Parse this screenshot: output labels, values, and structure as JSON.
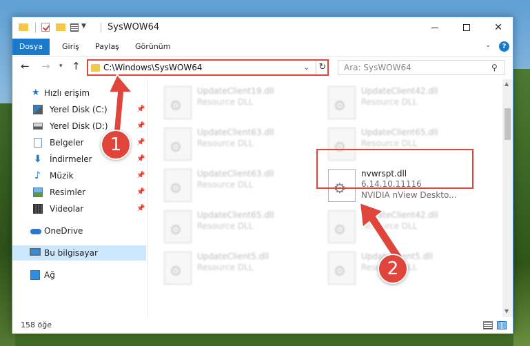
{
  "window": {
    "title": "SysWOW64"
  },
  "ribbon": {
    "tabs": [
      "Dosya",
      "Giriş",
      "Paylaş",
      "Görünüm"
    ]
  },
  "address": {
    "path": "C:\\Windows\\SysWOW64"
  },
  "search": {
    "placeholder": "Ara: SysWOW64"
  },
  "navpane": {
    "items": [
      {
        "label": "Hızlı erişim",
        "icon": "star-icon"
      },
      {
        "label": "Yerel Disk (C:)",
        "icon": "drive-icon",
        "pinned": true
      },
      {
        "label": "Yerel Disk (D:)",
        "icon": "drive-icon",
        "pinned": true
      },
      {
        "label": "Belgeler",
        "icon": "documents-icon",
        "pinned": true
      },
      {
        "label": "İndirmeler",
        "icon": "download-icon",
        "pinned": true
      },
      {
        "label": "Müzik",
        "icon": "music-icon",
        "pinned": true
      },
      {
        "label": "Resimler",
        "icon": "pictures-icon",
        "pinned": true
      },
      {
        "label": "Videolar",
        "icon": "videos-icon",
        "pinned": true
      },
      {
        "label": "OneDrive",
        "icon": "onedrive-icon"
      },
      {
        "label": "Bu bilgisayar",
        "icon": "this-pc-icon",
        "selected": true
      },
      {
        "label": "Ağ",
        "icon": "network-icon"
      }
    ]
  },
  "files": [
    {
      "name": "UpdateClient19.dll",
      "desc": "Resource DLL"
    },
    {
      "name": "UpdateClient42.dll",
      "desc": "Resource DLL"
    },
    {
      "name": "UpdateClient63.dll",
      "desc": "Resource DLL"
    },
    {
      "name": "UpdateClient65.dll",
      "desc": "Resource DLL"
    },
    {
      "name": "UpdateClient63.dll",
      "desc": "Resource DLL"
    },
    {
      "name": "nvwrspt.dll",
      "version": "6.14.10.11116",
      "desc": "NVIDIA nView Deskto..."
    },
    {
      "name": "UpdateClient65.dll",
      "desc": "Resource DLL"
    },
    {
      "name": "UpdateClient42.dll",
      "desc": "Resource DLL"
    },
    {
      "name": "UpdateClient5.dll",
      "desc": "Resource DLL"
    },
    {
      "name": "UpdateClient5.dll",
      "desc": "Resource DLL"
    }
  ],
  "status": {
    "item_count": "158 öğe"
  },
  "callouts": [
    "1",
    "2"
  ],
  "colors": {
    "accent": "#1979ca",
    "callout": "#e0453c",
    "selection": "#cce8ff"
  }
}
